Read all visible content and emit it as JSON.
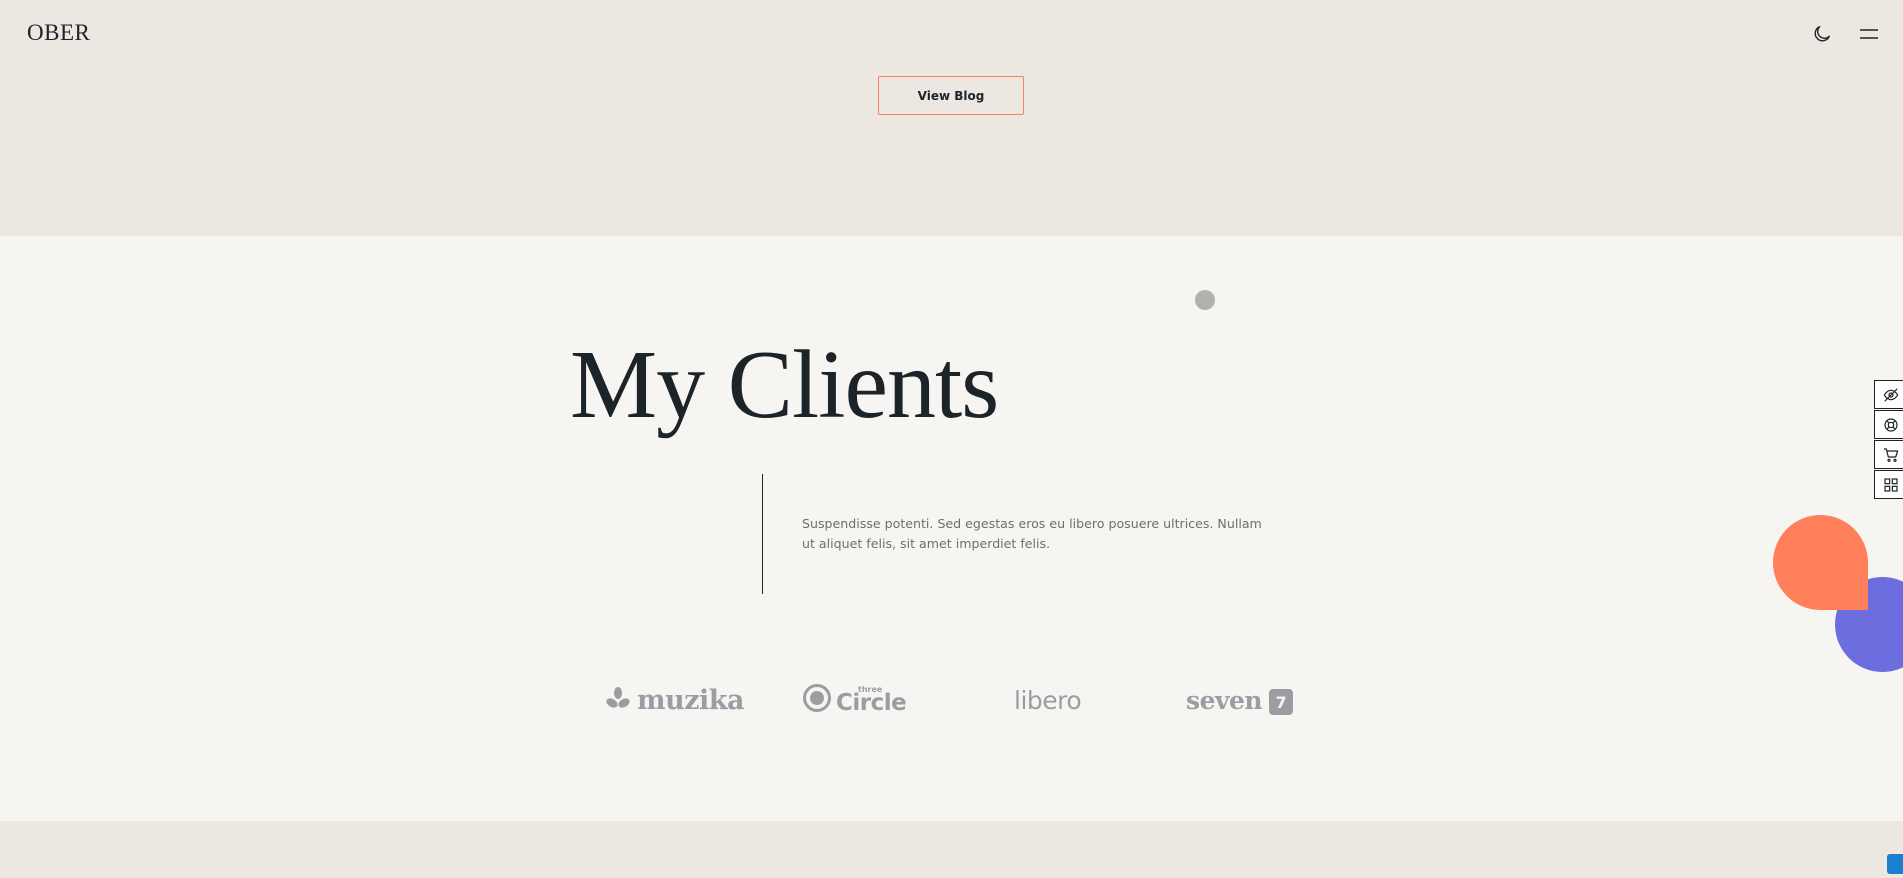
{
  "header": {
    "logo": "OBER",
    "blog_button_label": "View Blog",
    "icons": [
      "moon-icon",
      "menu-icon"
    ]
  },
  "clients": {
    "title": "My Clients",
    "description": "Suspendisse potenti. Sed egestas eros eu libero posuere ultrices. Nullam ut aliquet felis, sit amet imperdiet felis.",
    "logos": [
      {
        "name": "muzika",
        "text": "muzika"
      },
      {
        "name": "three-circle",
        "small": "three",
        "big": "Circle"
      },
      {
        "name": "libero",
        "text": "libero"
      },
      {
        "name": "seven",
        "text": "seven",
        "badge": "7"
      }
    ]
  },
  "side_tools": [
    "eye-off-icon",
    "support-icon",
    "cart-icon",
    "grid-icon"
  ],
  "colors": {
    "accent": "#ff7f5a",
    "secondary": "#6c6ddf",
    "text": "#1c2429",
    "logo_gray": "#9a9ea3",
    "page_bg": "#ece7e1",
    "section_bg": "#f7f5f2"
  }
}
